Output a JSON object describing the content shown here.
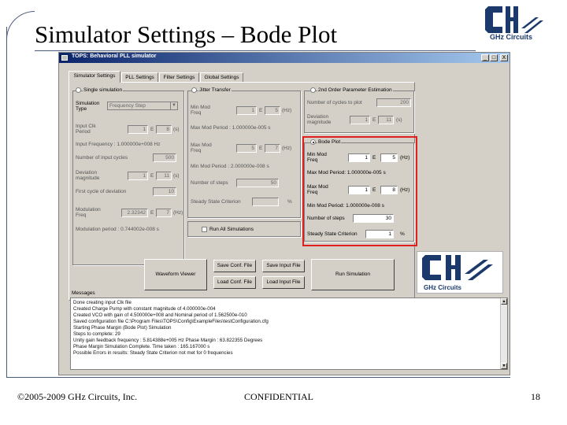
{
  "slide": {
    "title": "Simulator Settings – Bode Plot",
    "logo_caption": "GHz Circuits",
    "footer_copyright": "©2005-2009 GHz Circuits, Inc.",
    "footer_confidential": "CONFIDENTIAL",
    "page_number": "18"
  },
  "window": {
    "title": "TOPS: Behavioral PLL simulator",
    "controls": [
      "_",
      "□",
      "X"
    ]
  },
  "tabs": [
    "Simulator Settings",
    "PLL Settings",
    "Filter Settings",
    "Global Settings"
  ],
  "single_sim": {
    "radio_label": "Single simulation",
    "sim_type_label": "Simulation Type",
    "sim_type_value": "Frequency Step",
    "input_clk_label": "Input Clk Period",
    "input_clk_mantissa": "1",
    "input_clk_exp": "8",
    "input_clk_unit": "(s)",
    "input_freq_label": "Input Frequency : 1.000000e+008 Hz",
    "num_input_cycles_label": "Number of input cycles",
    "num_input_cycles_value": "500",
    "deviation_label": "Deviation magnitude",
    "deviation_mantissa": "1",
    "deviation_exp": "11",
    "deviation_unit": "(s)",
    "first_cycle_label": "First cycle of deviation",
    "first_cycle_value": "10",
    "mod_freq_label": "Modulation Freq",
    "mod_freq_mantissa": "2.32342",
    "mod_freq_exp": "7",
    "mod_freq_unit": "(Hz)",
    "mod_period_label": "Modulation period : 0.744002e-008 s"
  },
  "jitter": {
    "radio_label": "Jitter Transfer",
    "min_mod_freq_label": "Min Mod Freq",
    "min_mod_freq_mantissa": "1",
    "min_mod_freq_exp": "5",
    "min_mod_freq_unit": "(Hz)",
    "max_mod_period_label": "Max Mod Period : 1.000000e-005 s",
    "max_mod_freq_label": "Max Mod Freq",
    "max_mod_freq_mantissa": "5",
    "max_mod_freq_exp": "7",
    "max_mod_freq_unit": "(Hz)",
    "min_mod_period_label": "Min Mod Period : 2.000000e-008 s",
    "num_steps_label": "Number of steps",
    "num_steps_value": "50",
    "steady_label": "Steady State Criterion",
    "steady_value": "",
    "steady_unit": "%"
  },
  "second_order": {
    "radio_label": "2nd Order Parameter Estimation",
    "num_cycles_label": "Number of cycles to plot",
    "num_cycles_value": "200",
    "deviation_label": "Deviation magnitude",
    "deviation_mantissa": "1",
    "deviation_exp": "11",
    "deviation_unit": "(s)"
  },
  "bode": {
    "radio_label": "Bode Plot",
    "min_mod_freq_label": "Min Mod Freq",
    "min_mod_freq_mantissa": "1",
    "min_mod_freq_exp": "5",
    "min_mod_freq_unit": "(Hz)",
    "max_mod_period_label": "Max Mod Period: 1.000000e-005 s",
    "max_mod_freq_label": "Max Mod Freq",
    "max_mod_freq_mantissa": "1",
    "max_mod_freq_exp": "8",
    "max_mod_freq_unit": "(Hz)",
    "min_mod_period_label": "Min Mod Period: 1.000000e-008 s",
    "num_steps_label": "Number of steps",
    "num_steps_value": "30",
    "steady_label": "Steady State Criterion",
    "steady_value": "1",
    "steady_unit": "%"
  },
  "run_all": {
    "label": "Run All Simulations"
  },
  "buttons": {
    "waveform_viewer": "Waveform Viewer",
    "save_conf": "Save Conf. File",
    "load_conf": "Load Conf. File",
    "save_input": "Save Input File",
    "load_input": "Load Input File",
    "run_simulation": "Run Simulation"
  },
  "messages": {
    "label": "Messages",
    "lines": [
      "Done creating input Clk file",
      "Created Charge Pump with constant magnitude of 4.000000e-004",
      "Created VCO with gain of 4.500000e+008 and Nominal period of 1.562500e-010",
      "Saved configuration file C:\\Program Files\\TOPS\\Config\\ExampleFiles\\testConfiguration.cfg",
      "Starting Phase Margin (Bode Plot) Simulation",
      "Steps to complete: 29",
      "Unity gain feedback frequency : 5.814388e+005 Hz  Phase Margin : 63.822355 Degrees",
      "Phase Margin Simulation Complete. Time taken : 165.167000 s",
      "Possible Errors in results: Steady State Criterion not met for 0 frequencies"
    ]
  }
}
